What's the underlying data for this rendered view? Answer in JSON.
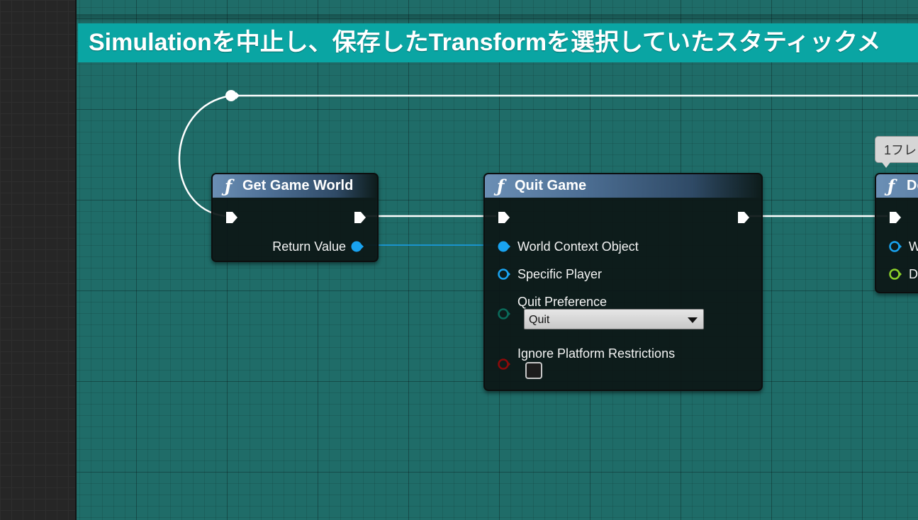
{
  "comment": {
    "text": "Simulationを中止し、保存したTransformを選択していたスタティックメ"
  },
  "nodes": {
    "get_game_world": {
      "function_icon": "ƒ",
      "title": "Get Game World",
      "return_value_label": "Return Value"
    },
    "quit_game": {
      "function_icon": "ƒ",
      "title": "Quit Game",
      "world_context_label": "World Context Object",
      "specific_player_label": "Specific Player",
      "quit_preference_label": "Quit Preference",
      "quit_preference_value": "Quit",
      "ignore_restrictions_label": "Ignore Platform Restrictions",
      "ignore_restrictions_checked": false
    },
    "delay": {
      "function_icon": "ƒ",
      "title": "De",
      "pin1_label": "W",
      "pin2_label": "D"
    }
  },
  "tooltip": {
    "text": "1フレ"
  },
  "colors": {
    "exec_wire": "#ffffff",
    "object_pin": "#19a3f0",
    "enum_pin": "#0a6a5a",
    "bool_pin": "#8c0a0a",
    "float_pin": "#8dd12a",
    "comment_bg": "#0aa5a3",
    "graph_bg": "#1f6c68",
    "header_blue": "#6b8fb5"
  },
  "icons": {
    "exec": "exec-pin-icon",
    "function": "function-icon",
    "dropdown": "chevron-down-icon"
  }
}
